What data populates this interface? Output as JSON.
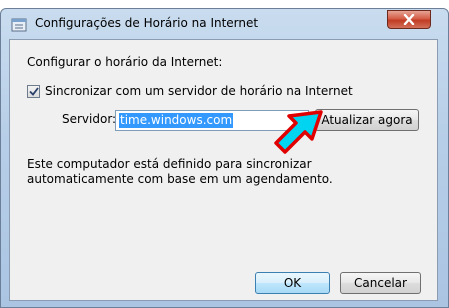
{
  "window": {
    "title": "Configurações de Horário na Internet"
  },
  "content": {
    "heading": "Configurar o horário da Internet:",
    "sync_checkbox": {
      "label": "Sincronizar com um servidor de horário na Internet",
      "checked": true
    },
    "server": {
      "label": "Servidor:",
      "value": "time.windows.com"
    },
    "update_button_label": "Atualizar agora",
    "description": "Este computador está definido para sincronizar automaticamente com base em um agendamento."
  },
  "footer": {
    "ok_label": "OK",
    "cancel_label": "Cancelar"
  },
  "annotation": {
    "arrow_fill": "#00d4f0",
    "arrow_stroke": "#e10000",
    "icon": "pointer-arrow-icon"
  }
}
